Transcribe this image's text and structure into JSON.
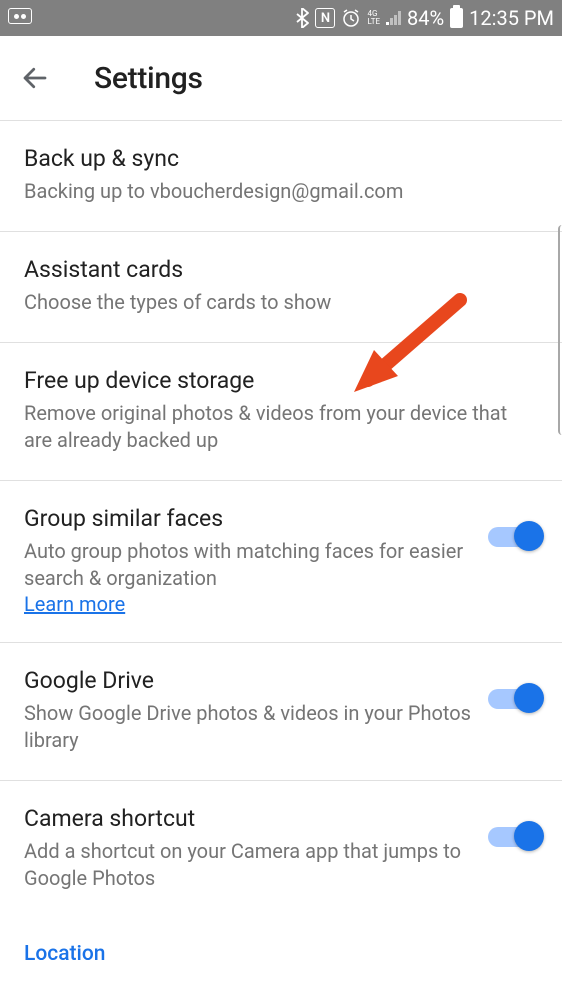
{
  "statusbar": {
    "battery_percent": "84%",
    "time": "12:35 PM",
    "nfc": "N",
    "lte": "4G\nLTE"
  },
  "header": {
    "title": "Settings"
  },
  "rows": {
    "backup": {
      "label": "Back up & sync",
      "sub": "Backing up to vboucherdesign@gmail.com"
    },
    "assistant": {
      "label": "Assistant cards",
      "sub": "Choose the types of cards to show"
    },
    "freeup": {
      "label": "Free up device storage",
      "sub": "Remove original photos & videos from your device that are already backed up"
    },
    "faces": {
      "label": "Group similar faces",
      "sub": "Auto group photos with matching faces for easier search & organization",
      "link": "Learn more"
    },
    "drive": {
      "label": "Google Drive",
      "sub": "Show Google Drive photos & videos in your Photos library"
    },
    "camera": {
      "label": "Camera shortcut",
      "sub": "Add a shortcut on your Camera app that jumps to Google Photos"
    }
  },
  "section": {
    "location": "Location"
  }
}
